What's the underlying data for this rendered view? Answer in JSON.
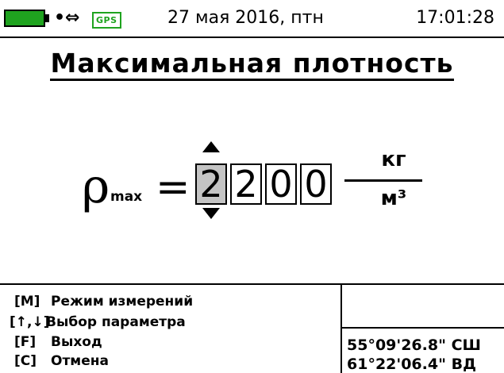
{
  "status": {
    "usb_symbol": "•⇔",
    "gps_label": "GPS",
    "date": "27 мая 2016, птн",
    "time": "17:01:28",
    "battery_color": "#1fa31f"
  },
  "title": "Максимальная плотность",
  "formula": {
    "symbol": "ρ",
    "subscript": "max",
    "equals": "=",
    "digits": [
      "2",
      "2",
      "0",
      "0"
    ],
    "selected_digit_index": 0,
    "unit_numerator": "кг",
    "unit_denominator": "м³"
  },
  "help": [
    {
      "key": "[M]",
      "text": "Режим измерений"
    },
    {
      "key": "[↑,↓]",
      "text": "Выбор параметра"
    },
    {
      "key": "[F]",
      "text": "Выход"
    },
    {
      "key": "[C]",
      "text": "Отмена"
    }
  ],
  "coordinates": {
    "lat": "55°09'26.8\" СШ",
    "lon": "61°22'06.4\" ВД"
  }
}
